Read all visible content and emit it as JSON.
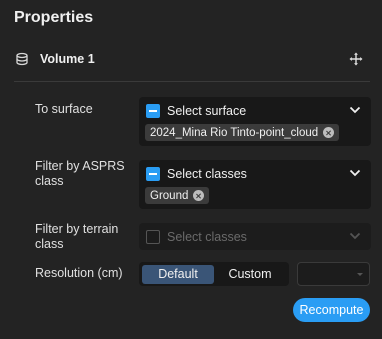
{
  "panel": {
    "title": "Properties"
  },
  "volume": {
    "label": "Volume 1",
    "icon": "database-icon",
    "action_icon": "move-icon"
  },
  "to_surface": {
    "label": "To surface",
    "placeholder": "Select surface",
    "checked": true,
    "chips": [
      "2024_Mina Rio Tinto-point_cloud"
    ]
  },
  "filter_asprs": {
    "label_line1": "Filter by ASPRS",
    "label_line2": "class",
    "placeholder": "Select classes",
    "checked": true,
    "chips": [
      "Ground"
    ]
  },
  "filter_terrain": {
    "label_line1": "Filter by terrain",
    "label_line2": "class",
    "placeholder": "Select classes",
    "checked": false,
    "disabled": true
  },
  "resolution": {
    "label": "Resolution (cm)",
    "options": [
      "Default",
      "Custom"
    ],
    "selected": "Default",
    "value": ""
  },
  "actions": {
    "recompute_label": "Recompute"
  },
  "colors": {
    "accent": "#2a9df4",
    "background": "#232323",
    "field": "#181818",
    "segment_active": "#3a5577"
  }
}
